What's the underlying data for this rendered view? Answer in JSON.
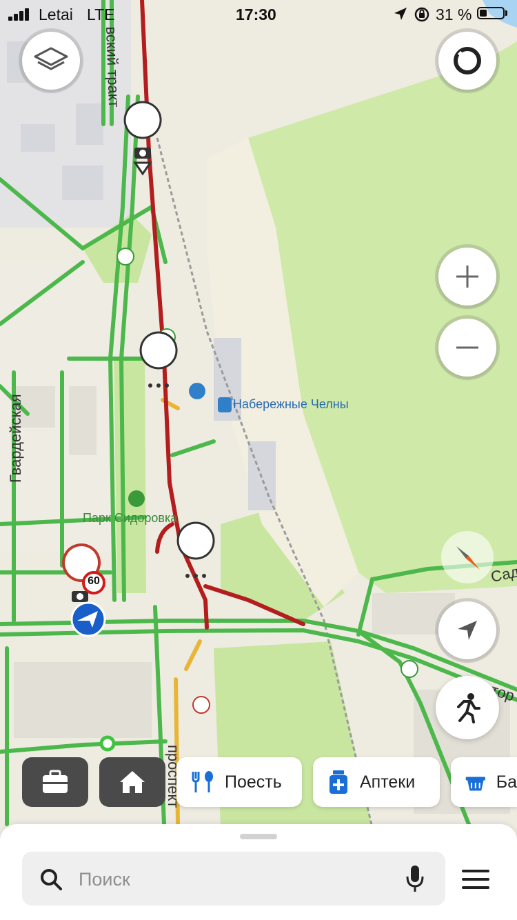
{
  "status_bar": {
    "carrier": "Letai",
    "network": "LTE",
    "time": "17:30",
    "battery": "31 %",
    "battery_level": 0.31
  },
  "map": {
    "road_labels": {
      "trakt": "вский тракт",
      "gvardeyskaya": "Гвардейская",
      "prospekt": "проспект",
      "sad": "Сад",
      "tor": "тор"
    },
    "poi_labels": {
      "station": "Набережные Челны",
      "park": "Парк Сидоровка"
    },
    "speed_limit": "60",
    "colors": {
      "free": "#4cb84c",
      "slow": "#e8b537",
      "jam": "#b31d1d",
      "accent": "#1a5fc9"
    }
  },
  "controls": {
    "layers_icon": "layers-icon",
    "alice_icon": "alice-icon",
    "zoom_in_icon": "plus-icon",
    "zoom_out_icon": "minus-icon",
    "compass_icon": "compass-icon",
    "locate_icon": "navigation-arrow-icon",
    "walk_icon": "pedestrian-icon"
  },
  "quick_actions": {
    "work_icon": "briefcase-icon",
    "home_icon": "home-icon",
    "chips": [
      {
        "label": "Поесть",
        "icon": "fork-spoon-icon"
      },
      {
        "label": "Аптеки",
        "icon": "pharmacy-icon"
      },
      {
        "label": "Ба",
        "icon": "basket-icon"
      }
    ]
  },
  "search": {
    "placeholder": "Поиск"
  }
}
